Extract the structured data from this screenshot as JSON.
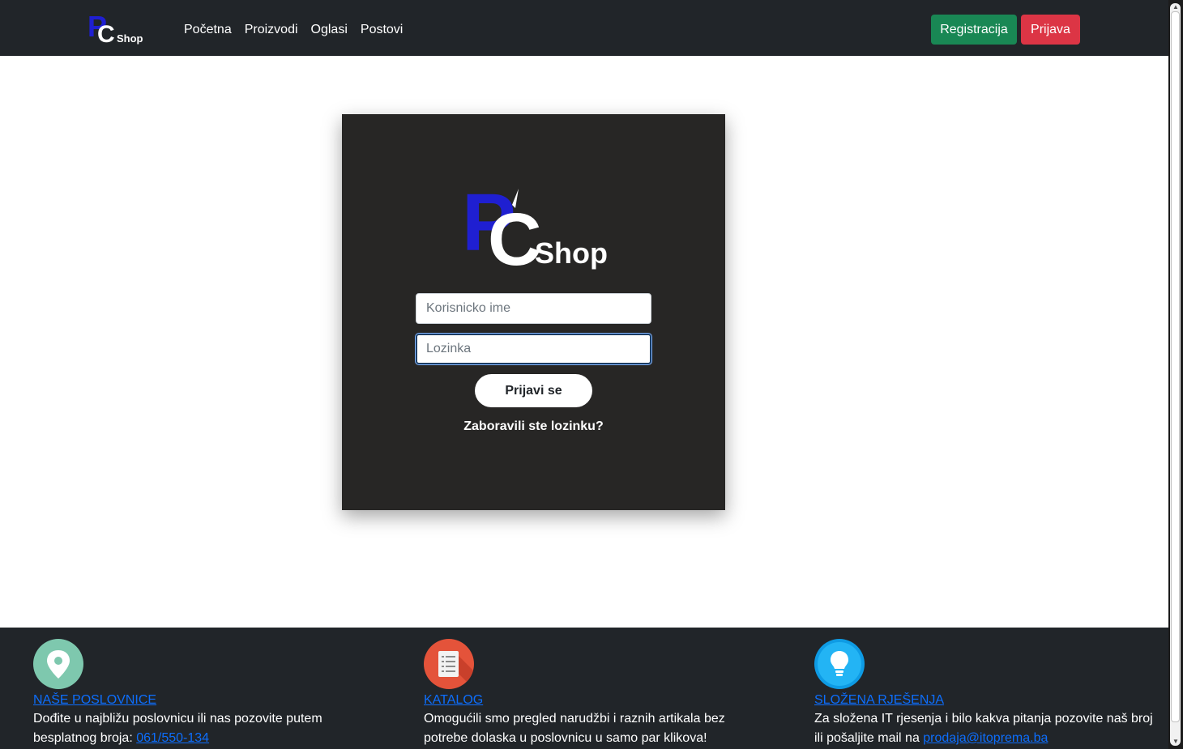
{
  "brand": {
    "logo_letters": "PC",
    "logo_word": "Shop",
    "colors": {
      "blue": "#1f1fd1",
      "white": "#ffffff"
    }
  },
  "nav": {
    "links": [
      "Početna",
      "Proizvodi",
      "Oglasi",
      "Postovi"
    ],
    "register_label": "Registracija",
    "login_label": "Prijava",
    "colors": {
      "register": "#198754",
      "login": "#dc3545",
      "bar": "#212529"
    }
  },
  "login": {
    "username_placeholder": "Korisnicko ime",
    "username_value": "",
    "password_placeholder": "Lozinka",
    "password_value": "",
    "submit_label": "Prijavi se",
    "forgot_label": "Zaboravili ste lozinku?",
    "card_color": "#272625"
  },
  "footer": {
    "columns": [
      {
        "icon": "location-pin-icon",
        "title": "NAŠE POSLOVNICE",
        "text": "Dođite u najbližu poslovnicu ili nas pozovite putem besplatnog broja: ",
        "link": "061/550-134"
      },
      {
        "icon": "document-list-icon",
        "title": "KATALOG",
        "text": "Omogućili smo pregled narudžbi i raznih artikala bez potrebe dolaska u poslovnicu u samo par klikova!",
        "link": ""
      },
      {
        "icon": "lightbulb-icon",
        "title": "SLOŽENA RJEŠENJA",
        "text": "Za složena IT rjesenja i bilo kakva pitanja pozovite naš broj ili pošaljite mail na ",
        "link": "prodaja@itoprema.ba"
      }
    ]
  }
}
